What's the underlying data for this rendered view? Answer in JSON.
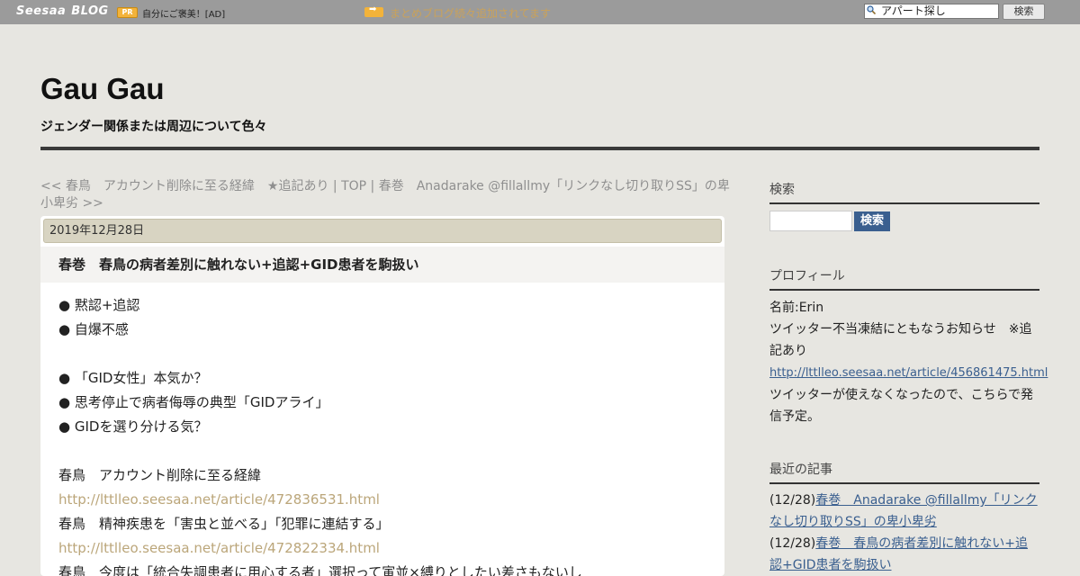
{
  "topbar": {
    "logo": "Seesaa",
    "logo_suffix": "BLOG",
    "pr_badge": "PR",
    "pr_text": "自分にご褒美！[AD]",
    "notice": "まとめブログ続々追加されてます",
    "search_value": "アパート探し",
    "search_button": "検索"
  },
  "header": {
    "title": "Gau Gau",
    "description": "ジェンダー関係または周辺について色々"
  },
  "nav": {
    "prev": "<< 春鳥　アカウント削除に至る経緯　★追記あり",
    "sep1": " | ",
    "top": "TOP",
    "sep2": " | ",
    "next": "春巻　Anadarake @fillallmy「リンクなし切り取りSS」の卑小卑劣 >>"
  },
  "article": {
    "date": "2019年12月28日",
    "title": "春巻　春鳥の病者差別に触れない+追認+GID患者を駒扱い",
    "lines": [
      {
        "text": "● 黙認+追認",
        "link": false
      },
      {
        "text": "● 自爆不感",
        "link": false
      },
      {
        "text": "",
        "link": false
      },
      {
        "text": "● 「GID女性」本気か？",
        "link": false
      },
      {
        "text": "● 思考停止で病者侮辱の典型「GIDアライ」",
        "link": false
      },
      {
        "text": "● GIDを選り分ける気？",
        "link": false
      },
      {
        "text": "",
        "link": false
      },
      {
        "text": "春鳥　アカウント削除に至る経緯",
        "link": false
      },
      {
        "text": "http://lttlleo.seesaa.net/article/472836531.html",
        "link": true
      },
      {
        "text": "春鳥　精神疾患を「害虫と並べる」「犯罪に連結する」",
        "link": false
      },
      {
        "text": "http://lttlleo.seesaa.net/article/472822334.html",
        "link": true
      },
      {
        "text": "春鳥　今度は「統合失調患者に用心する者」選択って寅並×縛りとしたい差さもないし",
        "link": false
      }
    ]
  },
  "sidebar": {
    "search_heading": "検索",
    "search_button": "検索",
    "profile_heading": "プロフィール",
    "profile_name": "名前:Erin",
    "profile_text1": "ツイッター不当凍結にともなうお知らせ　※追記あり",
    "profile_url": "http://lttlleo.seesaa.net/article/456861475.html",
    "profile_text2": "ツイッターが使えなくなったので、こちらで発信予定。",
    "recent_heading": "最近の記事",
    "recent": [
      {
        "date": "(12/28)",
        "title": "春巻　Anadarake @fillallmy「リンクなし切り取りSS」の卑小卑劣"
      },
      {
        "date": "(12/28)",
        "title": "春巻　春鳥の病者差別に触れない+追認+GID患者を駒扱い"
      }
    ]
  },
  "colors": {
    "topbar": "#9b9b9b",
    "background": "#e7e6e1",
    "link": "#3a5f8f",
    "article_link": "#bba67a",
    "date_bar": "#d8d4c2"
  }
}
